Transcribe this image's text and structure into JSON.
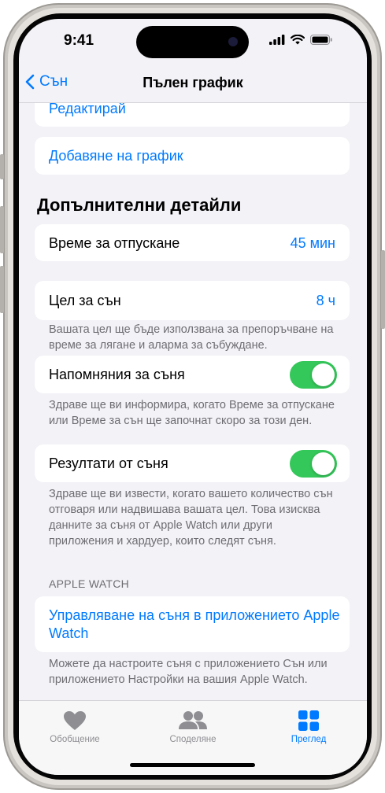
{
  "status": {
    "time": "9:41"
  },
  "nav": {
    "back_label": "Сън",
    "title": "Пълен график"
  },
  "schedule": {
    "edit_label": "Редактирай",
    "add_label": "Добавяне на график"
  },
  "details": {
    "title": "Допълнителни детайли",
    "wind_down": {
      "label": "Време за отпускане",
      "value": "45 мин"
    },
    "sleep_goal": {
      "label": "Цел за сън",
      "value": "8 ч",
      "note": "Вашата цел ще бъде използвана за препоръчване на време за лягане и аларма за събуждане."
    },
    "reminders": {
      "label": "Напомняния за съня",
      "on": true,
      "note": "Здраве ще ви информира, когато Време за отпускане или Време за сън ще започнат скоро за този ден."
    },
    "results": {
      "label": "Резултати от съня",
      "on": true,
      "note": "Здраве ще ви извести, когато вашето количество сън отговаря или надвишава вашата цел. Това изисква данните за съня от Apple Watch или други приложения и хардуер, които следят съня."
    }
  },
  "apple_watch": {
    "header": "APPLE WATCH",
    "manage_label": "Управляване на съня в приложението Apple Watch",
    "note": "Можете да настроите съня с приложението Сън или приложението Настройки на вашия Apple Watch."
  },
  "tabs": [
    {
      "label": "Обобщение",
      "icon": "heart-icon",
      "active": false
    },
    {
      "label": "Споделяне",
      "icon": "people-icon",
      "active": false
    },
    {
      "label": "Преглед",
      "icon": "grid-icon",
      "active": true
    }
  ],
  "colors": {
    "accent": "#007aff",
    "toggle_on": "#34c759",
    "background": "#f2f2f7"
  }
}
